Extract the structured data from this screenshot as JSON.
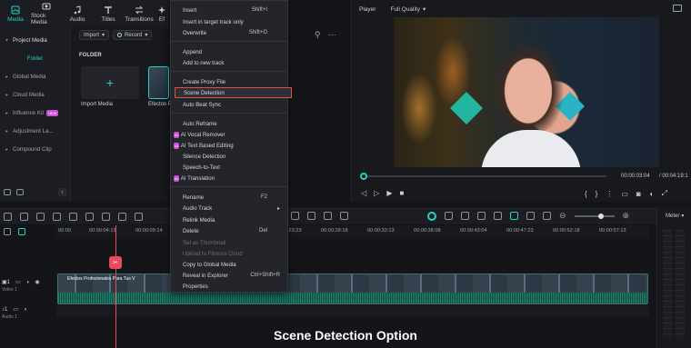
{
  "toolbar": {
    "tabs": [
      {
        "label": "Media",
        "icon": "media-icon"
      },
      {
        "label": "Stock Media",
        "icon": "stock-media-icon"
      },
      {
        "label": "Audio",
        "icon": "audio-icon"
      },
      {
        "label": "Titles",
        "icon": "titles-icon"
      },
      {
        "label": "Transitions",
        "icon": "transitions-icon"
      },
      {
        "label": "Ef",
        "icon": "effects-icon"
      }
    ],
    "accent": "#20d3c2"
  },
  "left_panel": {
    "items": [
      {
        "label": "Project Media"
      },
      {
        "label": "Folder"
      },
      {
        "label": "Global Media"
      },
      {
        "label": "Cloud Media"
      },
      {
        "label": "Influence Kit",
        "badge": "NEW"
      },
      {
        "label": "Adjustment La..."
      },
      {
        "label": "Compound Clip"
      }
    ]
  },
  "media": {
    "import_label": "Import",
    "record_label": "Record",
    "folder_heading": "FOLDER",
    "tiles": [
      {
        "label": "Import Media"
      },
      {
        "label": "Efectos P"
      }
    ]
  },
  "player": {
    "label": "Player",
    "quality": "Full Quality",
    "current_time": "00:00:03:04",
    "total_time": "/ 00:04:19:1"
  },
  "context_menu": {
    "items": [
      {
        "label": "Insert",
        "shortcut": "Shift+I"
      },
      {
        "label": "Insert in target track only",
        "shortcut": ""
      },
      {
        "label": "Overwrite",
        "shortcut": "Shift+O"
      },
      {
        "label": "Append",
        "shortcut": ""
      },
      {
        "label": "Add to new track",
        "shortcut": ""
      },
      {
        "label": "Create Proxy File",
        "shortcut": ""
      },
      {
        "label": "Scene Detection",
        "shortcut": ""
      },
      {
        "label": "Auto Beat Sync",
        "shortcut": ""
      },
      {
        "label": "Auto Reframe",
        "shortcut": ""
      },
      {
        "label": "AI Vocal Remover",
        "shortcut": ""
      },
      {
        "label": "AI Text Based Editing",
        "shortcut": ""
      },
      {
        "label": "Silence Detection",
        "shortcut": ""
      },
      {
        "label": "Speech-to-Text",
        "shortcut": ""
      },
      {
        "label": "AI Translation",
        "shortcut": ""
      },
      {
        "label": "Rename",
        "shortcut": "F2"
      },
      {
        "label": "Audio Track",
        "shortcut": ""
      },
      {
        "label": "Relink Media",
        "shortcut": ""
      },
      {
        "label": "Delete",
        "shortcut": "Del"
      },
      {
        "label": "Set as Thumbnail",
        "shortcut": ""
      },
      {
        "label": "Upload to Filmora Cloud",
        "shortcut": ""
      },
      {
        "label": "Copy to Global Media",
        "shortcut": ""
      },
      {
        "label": "Reveal in Explorer",
        "shortcut": "Ctrl+Shift+R"
      },
      {
        "label": "Properties",
        "shortcut": ""
      }
    ],
    "ai_badge": "AI"
  },
  "timeline": {
    "ruler": [
      "00:00",
      "00:00:04:19",
      "00:00:09:14",
      "00:00:23:23",
      "00:00:28:18",
      "00:00:33:13",
      "00:00:38:08",
      "00:00:43:04",
      "00:00:47:23",
      "00:00:52:18",
      "00:00:57:13"
    ],
    "tracks": [
      {
        "label": "Video 1"
      },
      {
        "label": "Audio 1"
      }
    ],
    "clip_title": "Efectos Profesionales Para Tus V",
    "meter_label": "Meter"
  },
  "caption": "Scene Detection Option"
}
